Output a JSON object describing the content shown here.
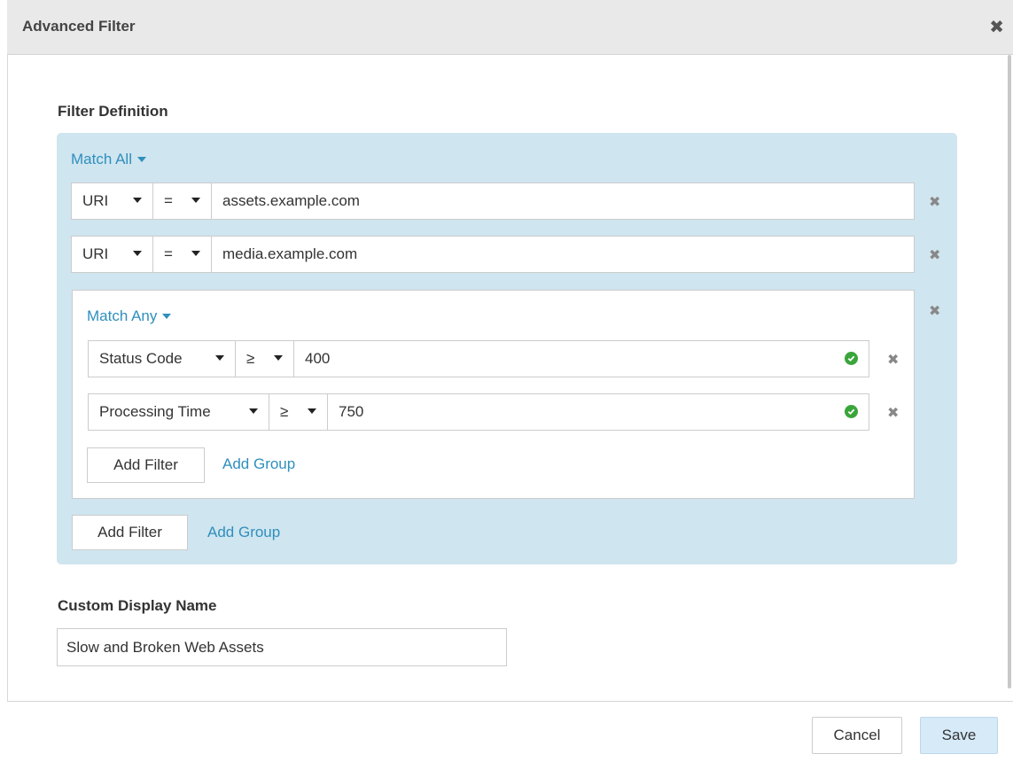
{
  "dialog": {
    "title": "Advanced Filter",
    "close_icon": "close-icon"
  },
  "filter_definition": {
    "label": "Filter Definition",
    "outer_group": {
      "match_label": "Match All",
      "rows": [
        {
          "field": "URI",
          "operator": "=",
          "value": "assets.example.com"
        },
        {
          "field": "URI",
          "operator": "=",
          "value": "media.example.com"
        }
      ],
      "inner_group": {
        "match_label": "Match Any",
        "rows": [
          {
            "field": "Status Code",
            "operator": "≥",
            "value": "400",
            "valid": true
          },
          {
            "field": "Processing Time",
            "operator": "≥",
            "value": "750",
            "valid": true
          }
        ],
        "add_filter_label": "Add Filter",
        "add_group_label": "Add Group"
      },
      "add_filter_label": "Add Filter",
      "add_group_label": "Add Group"
    }
  },
  "custom_display_name": {
    "label": "Custom Display Name",
    "value": "Slow and Broken Web Assets"
  },
  "footer": {
    "cancel_label": "Cancel",
    "save_label": "Save"
  },
  "colors": {
    "group_bg": "#cfe5ef",
    "link": "#2f8fbd",
    "valid": "#3aa53a",
    "save_bg": "#d6eaf8"
  }
}
